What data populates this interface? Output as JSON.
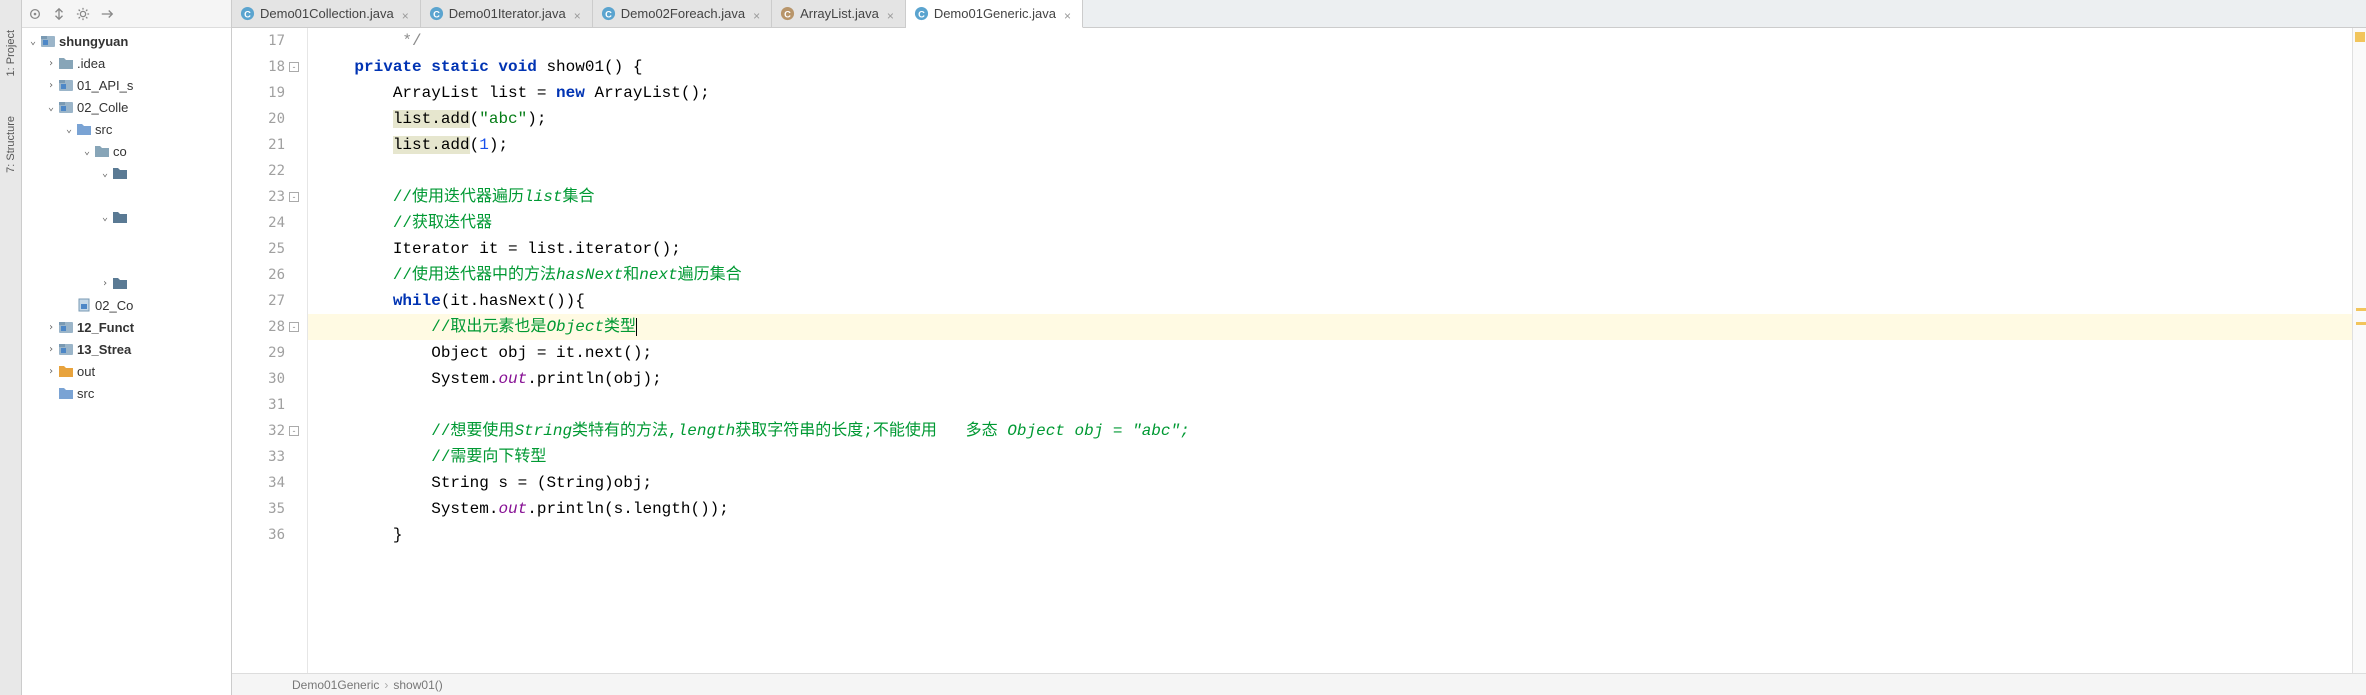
{
  "leftTabs": {
    "project": "1: Project",
    "structure": "7: Structure"
  },
  "projectTree": {
    "root": "shungyuan",
    "items": [
      {
        "indent": 0,
        "arrow": "v",
        "icon": "module",
        "label": "shungyuan",
        "bold": true
      },
      {
        "indent": 1,
        "arrow": ">",
        "icon": "folder",
        "label": ".idea"
      },
      {
        "indent": 1,
        "arrow": ">",
        "icon": "module",
        "label": "01_API_s"
      },
      {
        "indent": 1,
        "arrow": "v",
        "icon": "module",
        "label": "02_Colle"
      },
      {
        "indent": 2,
        "arrow": "v",
        "icon": "src",
        "label": "src"
      },
      {
        "indent": 3,
        "arrow": "v",
        "icon": "folder",
        "label": "co"
      },
      {
        "indent": 4,
        "arrow": "v",
        "icon": "folder-dark",
        "label": ""
      },
      {
        "indent": 4,
        "arrow": "",
        "icon": "",
        "label": ""
      },
      {
        "indent": 4,
        "arrow": "v",
        "icon": "folder-dark",
        "label": ""
      },
      {
        "indent": 4,
        "arrow": "",
        "icon": "",
        "label": ""
      },
      {
        "indent": 4,
        "arrow": "",
        "icon": "",
        "label": ""
      },
      {
        "indent": 4,
        "arrow": ">",
        "icon": "folder-dark",
        "label": ""
      },
      {
        "indent": 2,
        "arrow": "",
        "icon": "iml",
        "label": "02_Co"
      },
      {
        "indent": 1,
        "arrow": ">",
        "icon": "module",
        "label": "12_Funct",
        "bold": true
      },
      {
        "indent": 1,
        "arrow": ">",
        "icon": "module",
        "label": "13_Strea",
        "bold": true
      },
      {
        "indent": 1,
        "arrow": ">",
        "icon": "out",
        "label": "out"
      },
      {
        "indent": 1,
        "arrow": "",
        "icon": "src",
        "label": "src"
      }
    ]
  },
  "editorTabs": [
    {
      "label": "Demo01Collection.java",
      "icon": "java-class",
      "active": false
    },
    {
      "label": "Demo01Iterator.java",
      "icon": "java-class",
      "active": false
    },
    {
      "label": "Demo02Foreach.java",
      "icon": "java-class",
      "active": false
    },
    {
      "label": "ArrayList.java",
      "icon": "java-lib",
      "active": false
    },
    {
      "label": "Demo01Generic.java",
      "icon": "java-class",
      "active": true
    }
  ],
  "code": {
    "lines": [
      {
        "num": 17,
        "tokens": [
          {
            "t": "         */",
            "c": "comment"
          }
        ]
      },
      {
        "num": 18,
        "tokens": [
          {
            "t": "    ",
            "c": ""
          },
          {
            "t": "private static void",
            "c": "kw"
          },
          {
            "t": " show01() {",
            "c": ""
          }
        ]
      },
      {
        "num": 19,
        "tokens": [
          {
            "t": "        ArrayList list = ",
            "c": ""
          },
          {
            "t": "new",
            "c": "kw"
          },
          {
            "t": " ArrayList();",
            "c": ""
          }
        ]
      },
      {
        "num": 20,
        "tokens": [
          {
            "t": "        ",
            "c": ""
          },
          {
            "t": "list.add",
            "c": "method-bg"
          },
          {
            "t": "(",
            "c": ""
          },
          {
            "t": "\"abc\"",
            "c": "str"
          },
          {
            "t": ");",
            "c": ""
          }
        ]
      },
      {
        "num": 21,
        "tokens": [
          {
            "t": "        ",
            "c": ""
          },
          {
            "t": "list.add",
            "c": "method-bg"
          },
          {
            "t": "(",
            "c": ""
          },
          {
            "t": "1",
            "c": "num"
          },
          {
            "t": ");",
            "c": ""
          }
        ]
      },
      {
        "num": 22,
        "tokens": []
      },
      {
        "num": 23,
        "tokens": [
          {
            "t": "        ",
            "c": ""
          },
          {
            "t": "//使用迭代器遍历",
            "c": "comment-green"
          },
          {
            "t": "list",
            "c": "comment-green comment-italic"
          },
          {
            "t": "集合",
            "c": "comment-green"
          }
        ]
      },
      {
        "num": 24,
        "tokens": [
          {
            "t": "        ",
            "c": ""
          },
          {
            "t": "//获取迭代器",
            "c": "comment-green"
          }
        ]
      },
      {
        "num": 25,
        "tokens": [
          {
            "t": "        Iterator it = list.iterator();",
            "c": ""
          }
        ]
      },
      {
        "num": 26,
        "tokens": [
          {
            "t": "        ",
            "c": ""
          },
          {
            "t": "//使用迭代器中的方法",
            "c": "comment-green"
          },
          {
            "t": "hasNext",
            "c": "comment-green comment-italic"
          },
          {
            "t": "和",
            "c": "comment-green"
          },
          {
            "t": "next",
            "c": "comment-green comment-italic"
          },
          {
            "t": "遍历集合",
            "c": "comment-green"
          }
        ]
      },
      {
        "num": 27,
        "tokens": [
          {
            "t": "        ",
            "c": ""
          },
          {
            "t": "while",
            "c": "kw"
          },
          {
            "t": "(it.hasNext()){",
            "c": ""
          }
        ]
      },
      {
        "num": 28,
        "highlight": true,
        "tokens": [
          {
            "t": "            ",
            "c": ""
          },
          {
            "t": "//取出元素也是",
            "c": "comment-green"
          },
          {
            "t": "Object",
            "c": "comment-green comment-italic"
          },
          {
            "t": "类型",
            "c": "comment-green"
          },
          {
            "t": "",
            "c": "caret"
          }
        ]
      },
      {
        "num": 29,
        "tokens": [
          {
            "t": "            Object obj = it.next();",
            "c": ""
          }
        ]
      },
      {
        "num": 30,
        "tokens": [
          {
            "t": "            System.",
            "c": ""
          },
          {
            "t": "out",
            "c": "field"
          },
          {
            "t": ".println(obj);",
            "c": ""
          }
        ]
      },
      {
        "num": 31,
        "tokens": []
      },
      {
        "num": 32,
        "tokens": [
          {
            "t": "            ",
            "c": ""
          },
          {
            "t": "//想要使用",
            "c": "comment-green"
          },
          {
            "t": "String",
            "c": "comment-green comment-italic"
          },
          {
            "t": "类特有的方法,",
            "c": "comment-green"
          },
          {
            "t": "length",
            "c": "comment-green comment-italic"
          },
          {
            "t": "获取字符串的长度;不能使用   多态 ",
            "c": "comment-green"
          },
          {
            "t": "Object obj = \"abc\";",
            "c": "comment-green comment-italic"
          }
        ]
      },
      {
        "num": 33,
        "tokens": [
          {
            "t": "            ",
            "c": ""
          },
          {
            "t": "//需要向下转型",
            "c": "comment-green"
          }
        ]
      },
      {
        "num": 34,
        "tokens": [
          {
            "t": "            String s = (String)obj;",
            "c": ""
          }
        ]
      },
      {
        "num": 35,
        "tokens": [
          {
            "t": "            System.",
            "c": ""
          },
          {
            "t": "out",
            "c": "field"
          },
          {
            "t": ".println(s.length());",
            "c": ""
          }
        ]
      },
      {
        "num": 36,
        "tokens": [
          {
            "t": "        }",
            "c": ""
          }
        ]
      }
    ]
  },
  "breadcrumb": {
    "parts": [
      "Demo01Generic",
      "show01()"
    ]
  }
}
